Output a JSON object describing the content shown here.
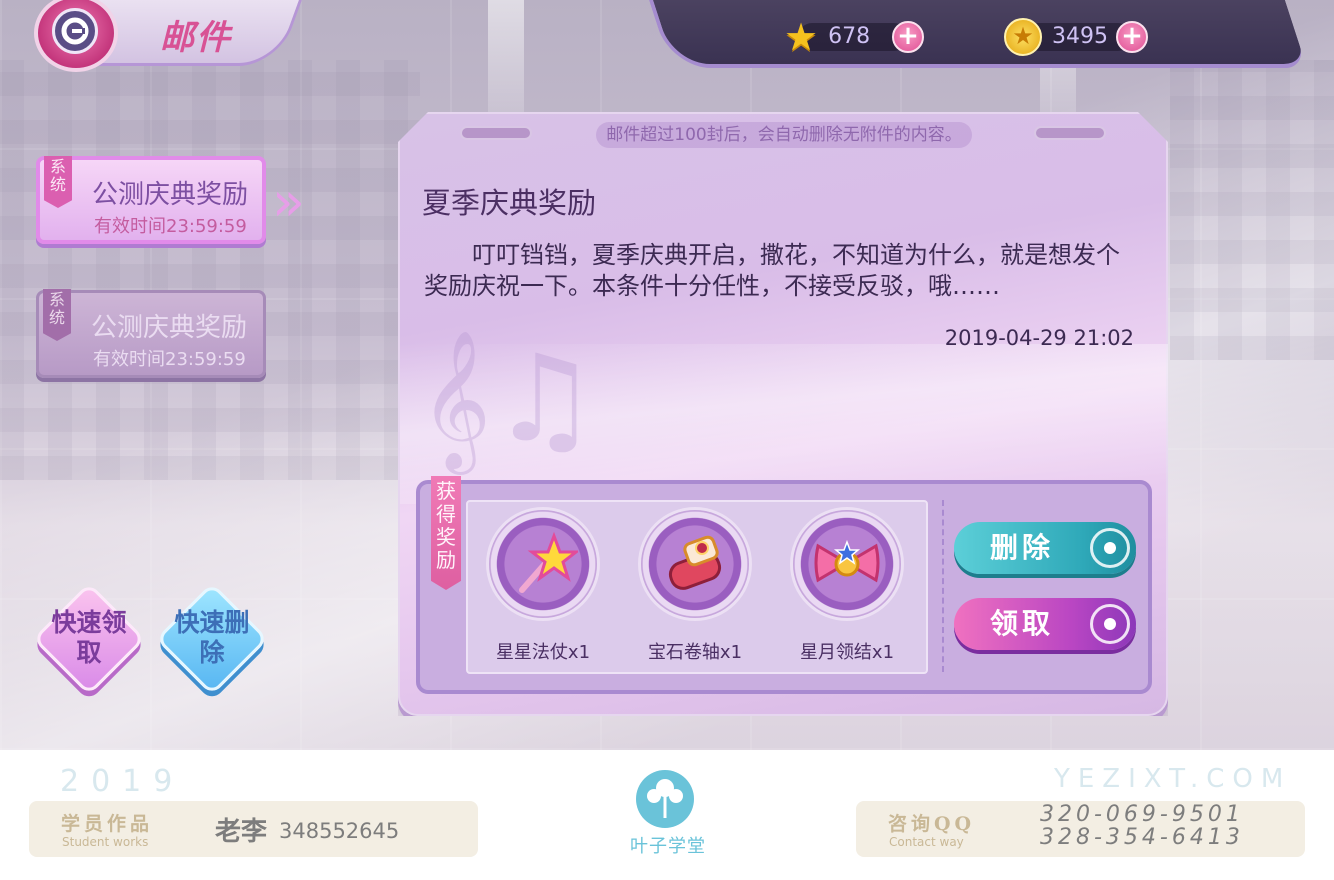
{
  "header": {
    "title": "邮件",
    "stars": "678",
    "coins": "3495",
    "plus_symbol": "+"
  },
  "mail_list": [
    {
      "tag": "系统",
      "title": "公测庆典奖励",
      "expiry": "有效时间23:59:59",
      "selected": true
    },
    {
      "tag": "系统",
      "title": "公测庆典奖励",
      "expiry": "有效时间23:59:59",
      "selected": false
    }
  ],
  "quick_actions": {
    "claim_all": "快速领取",
    "delete_all": "快速删除"
  },
  "mail_detail": {
    "notice": "邮件超过100封后，会自动删除无附件的内容。",
    "subject": "夏季庆典奖励",
    "body": "叮叮铛铛，夏季庆典开启，撒花，不知道为什么，就是想发个奖励庆祝一下。本条件十分任性，不接受反驳，哦……",
    "date": "2019-04-29 21:02"
  },
  "rewards": {
    "tag": "获得奖励",
    "items": [
      {
        "label": "星星法仗x1",
        "icon": "star-wand-icon"
      },
      {
        "label": "宝石卷轴x1",
        "icon": "gem-scroll-icon"
      },
      {
        "label": "星月领结x1",
        "icon": "star-moon-bow-icon"
      }
    ]
  },
  "actions": {
    "delete": "删除",
    "claim": "领取"
  },
  "footer": {
    "year": "2019",
    "site": "YEZIXT.COM",
    "student_works_cn": "学员作品",
    "student_works_en": "Student works",
    "student_name": "老李",
    "student_id": "348552645",
    "logo_text": "叶子学堂",
    "contact_cn": "咨询QQ",
    "contact_en": "Contact way",
    "phone1": "320-069-9501",
    "phone2": "328-354-6413"
  },
  "colors": {
    "accent_pink": "#d85295",
    "panel_purple": "#d9bde8",
    "delete_teal": "#2fa9b9",
    "claim_magenta": "#b946c3"
  }
}
